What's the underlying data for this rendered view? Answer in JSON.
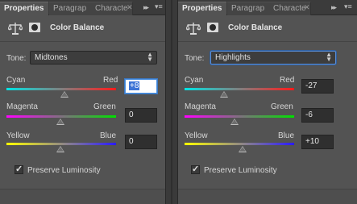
{
  "tabs": {
    "properties": "Properties",
    "paragraph": "Paragrap",
    "character": "Characte",
    "close": "✕",
    "collapse": "▸▸",
    "menu": "▾≡"
  },
  "panels": [
    {
      "header_title": "Color Balance",
      "tone_label": "Tone:",
      "tone_value": "Midtones",
      "sliders": [
        {
          "left": "Cyan",
          "right": "Red",
          "value": "+8",
          "level": 8
        },
        {
          "left": "Magenta",
          "right": "Green",
          "value": "0",
          "level": 0
        },
        {
          "left": "Yellow",
          "right": "Blue",
          "value": "0",
          "level": 0
        }
      ],
      "preserve_label": "Preserve Luminosity",
      "preserve_checked": true
    },
    {
      "header_title": "Color Balance",
      "tone_label": "Tone:",
      "tone_value": "Highlights",
      "sliders": [
        {
          "left": "Cyan",
          "right": "Red",
          "value": "-27",
          "level": -27
        },
        {
          "left": "Magenta",
          "right": "Green",
          "value": "-6",
          "level": -6
        },
        {
          "left": "Yellow",
          "right": "Blue",
          "value": "+10",
          "level": 10
        }
      ],
      "preserve_label": "Preserve Luminosity",
      "preserve_checked": true
    }
  ],
  "colors": {
    "cyan_red": [
      "#00e5e5",
      "#ff1a1a"
    ],
    "magenta_green": [
      "#ff00ff",
      "#00e000"
    ],
    "yellow_blue": [
      "#ffff00",
      "#2a1aff"
    ],
    "focus": "#4a90e2"
  }
}
